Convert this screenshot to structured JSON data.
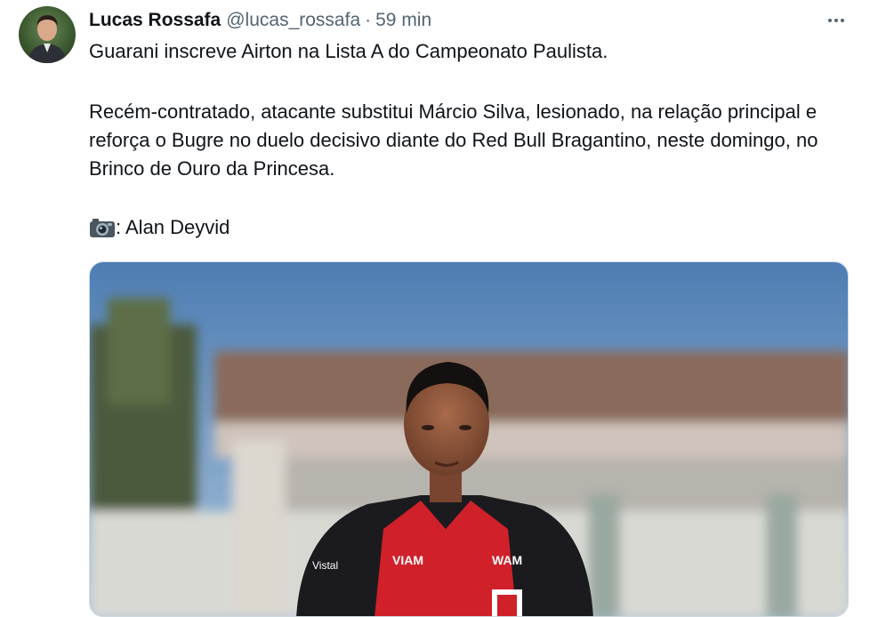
{
  "tweet": {
    "author_name": "Lucas Rossafa",
    "handle": "@lucas_rossafa",
    "separator": "·",
    "time": "59 min",
    "paragraph1": "Guarani inscreve Airton na Lista A do Campeonato Paulista.",
    "paragraph2": "Recém-contratado, atacante substitui Márcio Silva, lesionado, na relação principal e reforça o Bugre no duelo decisivo diante do Red Bull Bragantino, neste domingo, no Brinco de Ouro da Princesa.",
    "photo_credit": ": Alan Deyvid",
    "photo_icon": "camera-icon",
    "more_icon": "more-horizontal-icon"
  },
  "media": {
    "jersey_sponsor": "VIAM",
    "jersey_sponsor_right": "WAM",
    "shoulder_logo": "Vistal"
  },
  "colors": {
    "text_primary": "#0f1419",
    "text_secondary": "#536471",
    "jersey_red": "#d0202a",
    "jersey_black": "#1b1b1f"
  }
}
